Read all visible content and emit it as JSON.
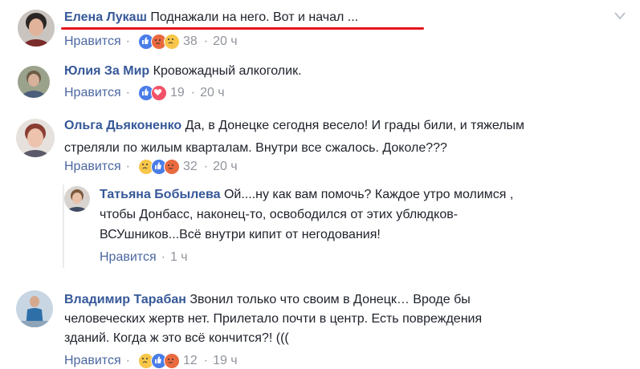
{
  "comments": [
    {
      "name": "Елена Лукаш",
      "text": "Поднажали на него. Вот и начал ...",
      "like_label": "Нравится",
      "reaction_count": "38",
      "time": "20 ч"
    },
    {
      "name": "Юлия За Мир",
      "text": "Кровожадный алкоголик.",
      "like_label": "Нравится",
      "reaction_count": "19",
      "time": "20 ч"
    },
    {
      "name": "Ольга Дьяконенко",
      "text_line1": "Да, в Донецке сегодня весело! И грады били, и тяжелым",
      "text_line2": "стреляли по жилым кварталам. Внутри все сжалось. Доколе???",
      "like_label": "Нравится",
      "reaction_count": "32",
      "time": "20 ч"
    },
    {
      "name": "Татьяна Бобылева",
      "text_line1": "Ой....ну как вам помочь? Каждое утро молимся ,",
      "text_line2": "чтобы Донбасс, наконец-то, освободился от этих ублюдков-",
      "text_line3": "ВСУшников...Всё внутри кипит от негодования!",
      "like_label": "Нравится",
      "time": "1 ч"
    },
    {
      "name": "Владимир Тарабан",
      "text_line1": "Звонил только что своим в Донецк… Вроде бы",
      "text_line2": "человеческих жертв нет. Прилетало почти в центр. Есть повреждения",
      "text_line3": "зданий. Когда ж это всё кончится?! (((",
      "like_label": "Нравится",
      "reaction_count": "12",
      "time": "19 ч"
    }
  ],
  "icons": {
    "reactions": [
      "like-icon",
      "love-icon",
      "sad-icon",
      "angry-icon"
    ],
    "menu": "chevron-down-icon"
  },
  "colors": {
    "name": "#365899",
    "meta": "#90949c",
    "underline": "#e3141c"
  }
}
